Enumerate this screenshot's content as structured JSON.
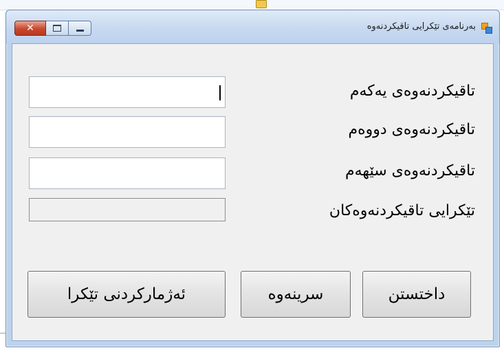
{
  "window": {
    "title": "بەرنامەی تێکرایی تاقیکردنەوە"
  },
  "form": {
    "fields": [
      {
        "label": "تاقیکردنەوەی یەکەم",
        "value": ""
      },
      {
        "label": "تاقیکردنەوەی دووەم",
        "value": ""
      },
      {
        "label": "تاقیکردنەوەی سێهەم",
        "value": ""
      },
      {
        "label": "تێکرایی تاقیکردنەوەکان",
        "value": ""
      }
    ]
  },
  "buttons": {
    "enter": "داختستن",
    "clear": "سرینەوە",
    "calculate": "ئەژمارکردنی تێکرا"
  }
}
